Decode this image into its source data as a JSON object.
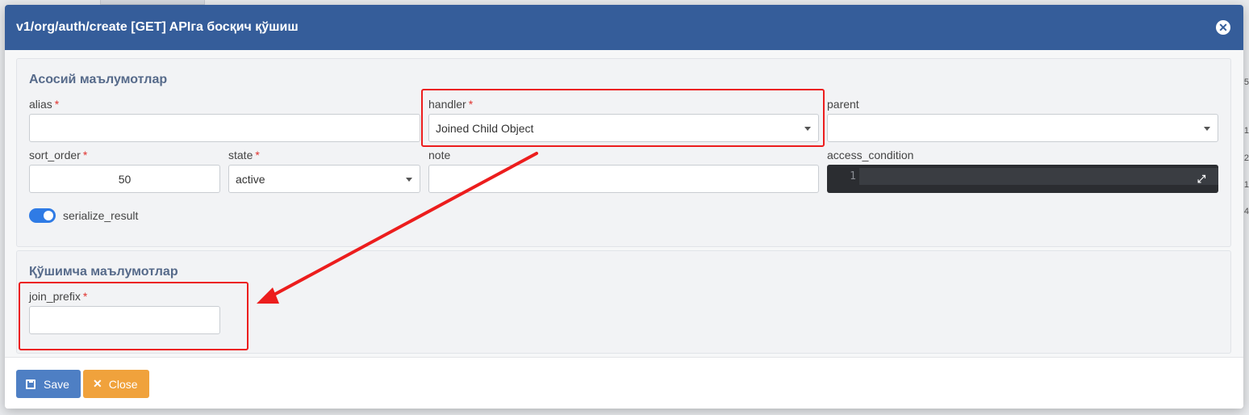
{
  "modal": {
    "title": "v1/org/auth/create [GET] APIга босқич қўшиш",
    "close_icon": "close-circle-icon"
  },
  "section_main": {
    "title": "Асосий маълумотлар",
    "alias": {
      "label": "alias",
      "value": ""
    },
    "handler": {
      "label": "handler",
      "value": "Joined Child Object"
    },
    "parent": {
      "label": "parent",
      "value": ""
    },
    "sort_order": {
      "label": "sort_order",
      "value": "50"
    },
    "state": {
      "label": "state",
      "value": "active"
    },
    "note": {
      "label": "note",
      "value": ""
    },
    "access_condition": {
      "label": "access_condition",
      "line_number": "1"
    },
    "serialize_result": {
      "label": "serialize_result",
      "enabled": true
    }
  },
  "section_extra": {
    "title": "Қўшимча маълумотлар",
    "join_prefix": {
      "label": "join_prefix",
      "value": ""
    }
  },
  "footer": {
    "save_label": "Save",
    "close_label": "Close"
  },
  "background": {
    "right_digits": [
      "5",
      "1",
      "2",
      "1",
      "4"
    ]
  },
  "colors": {
    "header": "#355d9a",
    "save": "#4e7fc4",
    "close": "#f0a23c",
    "annotation": "#ec1d1d",
    "toggle": "#2f7be5"
  }
}
